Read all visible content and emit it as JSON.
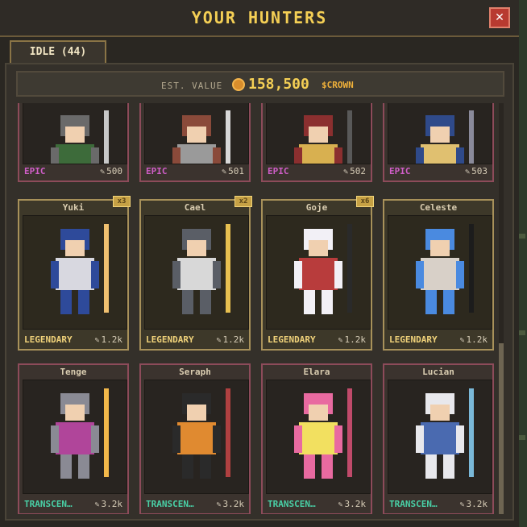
{
  "header": {
    "title": "YOUR HUNTERS",
    "close_label": "✕"
  },
  "tabs": [
    {
      "label": "IDLE (44)"
    }
  ],
  "estimate": {
    "label": "EST. VALUE",
    "amount": "158,500",
    "unit": "$CROWN"
  },
  "power_icon": "✎",
  "colors": {
    "accent": "#f4cf55",
    "epic": "#d05ec8",
    "legendary": "#f0d27a",
    "transcendent": "#49d0a6",
    "close": "#b83a30"
  },
  "epic_cards": [
    {
      "rarity": "EPIC",
      "power": "500",
      "palette": [
        "#6a6a6a",
        "#3d6b3a",
        "#c8c8c8"
      ]
    },
    {
      "rarity": "EPIC",
      "power": "501",
      "palette": [
        "#8a4a3a",
        "#9a9a9a",
        "#d8d8d8"
      ]
    },
    {
      "rarity": "EPIC",
      "power": "502",
      "palette": [
        "#8b2f2f",
        "#d8b050",
        "#595959"
      ]
    },
    {
      "rarity": "EPIC",
      "power": "503",
      "palette": [
        "#2f4a8a",
        "#e0c070",
        "#8a8a9a"
      ]
    }
  ],
  "legendary_cards": [
    {
      "name": "Yuki",
      "badge": "x3",
      "rarity": "LEGENDARY",
      "power": "1.2k",
      "palette": [
        "#2e4a9a",
        "#d8d8e0",
        "#f0c070"
      ]
    },
    {
      "name": "Cael",
      "badge": "x2",
      "rarity": "LEGENDARY",
      "power": "1.2k",
      "palette": [
        "#5a5e66",
        "#d8d8d8",
        "#e8c050"
      ]
    },
    {
      "name": "Goje",
      "badge": "x6",
      "rarity": "LEGENDARY",
      "power": "1.2k",
      "palette": [
        "#f2f0f6",
        "#b83c3c",
        "#2a2a2a"
      ]
    },
    {
      "name": "Celeste",
      "badge": "",
      "rarity": "LEGENDARY",
      "power": "1.2k",
      "palette": [
        "#4a8ae0",
        "#d8d0c8",
        "#1c1c1c"
      ]
    }
  ],
  "transcendent_cards": [
    {
      "name": "Tenge",
      "rarity": "TRANSCEN…",
      "power": "3.2k",
      "palette": [
        "#8a8a94",
        "#b0459a",
        "#f2b84a"
      ]
    },
    {
      "name": "Seraph",
      "rarity": "TRANSCEN…",
      "power": "3.2k",
      "palette": [
        "#2a2a2a",
        "#e08a30",
        "#b04040"
      ]
    },
    {
      "name": "Elara",
      "rarity": "TRANSCEN…",
      "power": "3.2k",
      "palette": [
        "#e86aa0",
        "#f2e060",
        "#c04a6a"
      ]
    },
    {
      "name": "Lucian",
      "rarity": "TRANSCEN…",
      "power": "3.2k",
      "palette": [
        "#e8e8ec",
        "#4a6ab0",
        "#7ab8d8"
      ]
    }
  ]
}
